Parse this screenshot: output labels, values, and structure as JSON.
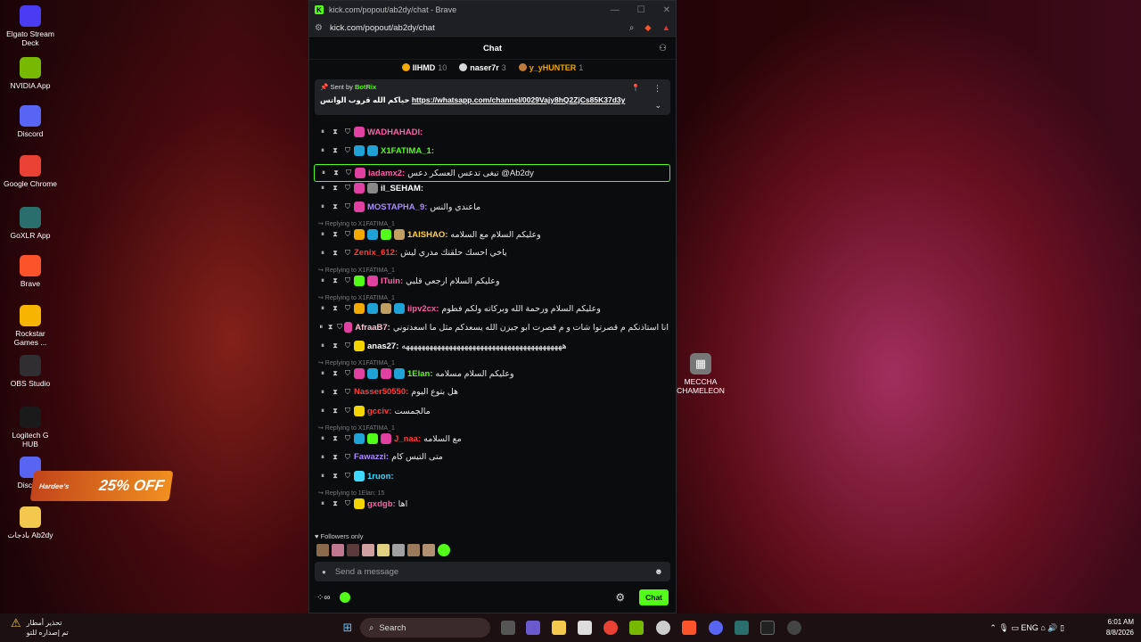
{
  "desktop_icons": [
    {
      "label": "Elgato Stream Deck",
      "icon": "stream-deck-icon",
      "color": "#4b3bf2"
    },
    {
      "label": "NVIDIA App",
      "icon": "nvidia-icon",
      "color": "#76b900"
    },
    {
      "label": "Discord",
      "icon": "discord-icon",
      "color": "#5865f2"
    },
    {
      "label": "Google Chrome",
      "icon": "chrome-icon",
      "color": "#e94235"
    },
    {
      "label": "GoXLR App",
      "icon": "goxlr-icon",
      "color": "#2b6e6e"
    },
    {
      "label": "Brave",
      "icon": "brave-icon",
      "color": "#fb542b"
    },
    {
      "label": "Rockstar Games ...",
      "icon": "rockstar-icon",
      "color": "#f7b500"
    },
    {
      "label": "OBS Studio",
      "icon": "obs-icon",
      "color": "#302e31"
    },
    {
      "label": "Logitech G HUB",
      "icon": "logitech-icon",
      "color": "#1a1a1a"
    },
    {
      "label": "Discord",
      "icon": "discord-icon",
      "color": "#5865f2"
    },
    {
      "label": "بادجات Ab2dy",
      "icon": "folder-icon",
      "color": "#f2c94c"
    }
  ],
  "desktop_right_icon": {
    "label": "MECCHA CHAMELEON"
  },
  "promo": {
    "brand": "Hardee's",
    "text": "25% OFF"
  },
  "browser": {
    "title": "kick.com/popout/ab2dy/chat - Brave",
    "url": "kick.com/popout/ab2dy/chat"
  },
  "chat": {
    "header": "Chat",
    "leaders": [
      {
        "name": "IIHMD",
        "count": "10",
        "color": "#f2a900"
      },
      {
        "name": "naser7r",
        "count": "3",
        "color": "#d9d9d9"
      },
      {
        "name": "y_yHUNTER",
        "count": "1",
        "color": "#c07a3a"
      }
    ],
    "pinned": {
      "sent_by_label": "Sent by",
      "sender": "BotRix",
      "text": "حياكم الله قروب الواتس",
      "link": "https://whatsapp.com/channel/0029Vajy8hQ2ZjCs85K37d3y"
    },
    "replying_prefix": "Replying to",
    "messages": [
      {
        "user": "WADHAHADI",
        "color": "#ff5fa8",
        "text": "",
        "badges": [
          "#e040a0"
        ]
      },
      {
        "user": "X1FATIMA_1",
        "color": "#53fc18",
        "text": "",
        "badges": [
          "#1fa3d6",
          "#1fa3d6"
        ]
      },
      {
        "user": "iadamx2",
        "color": "#ff5fa8",
        "text": "تبغى تدعس العسكر دعس @Ab2dy",
        "badges": [
          "#e040a0"
        ],
        "highlight": true
      },
      {
        "user": "il_SEHAM",
        "color": "#ffffff",
        "text": "",
        "badges": [
          "#e040a0",
          "#888888"
        ]
      },
      {
        "user": "MOSTAPHA_9",
        "color": "#a98bff",
        "text": "ماعندي والنس",
        "badges": [
          "#e040a0"
        ]
      },
      {
        "reply_to": "X1FATIMA_1",
        "user": "1AISHAO",
        "color": "#ffd23f",
        "text": "وعليكم السلام مع السلامه",
        "badges": [
          "#f2a900",
          "#1fa3d6",
          "#53fc18",
          "#c0a060"
        ]
      },
      {
        "user": "Zenix_612",
        "color": "#ff3b3b",
        "text": "ياخي احسك حلقنك مدري ليش",
        "badges": []
      },
      {
        "reply_to": "X1FATIMA_1",
        "user": "ITuin",
        "color": "#ff5fa8",
        "text": "وعليكم السلام ارجعي قلبي",
        "badges": [
          "#53fc18",
          "#e040a0"
        ]
      },
      {
        "reply_to": "X1FATIMA_1",
        "user": "iipv2cx",
        "color": "#ff5fa8",
        "text": "وعليكم السلام ورحمة الله وبركاته ولكم فطوم",
        "badges": [
          "#f2a900",
          "#1fa3d6",
          "#c0a060",
          "#1fa3d6"
        ]
      },
      {
        "user": "AfraaB7",
        "color": "#ffc0d0",
        "text": "انا استاذنكم م قصرتوا شات و م قصرت ابو جيزن الله يسعدكم مثل ما اسعدتوني",
        "badges": [
          "#e040a0"
        ]
      },
      {
        "user": "anas27",
        "color": "#ffffff",
        "text": "هههههههههههههههههههههههههههههههههههههههههه",
        "badges": [
          "#f2d400"
        ]
      },
      {
        "reply_to": "X1FATIMA_1",
        "user": "1Elan",
        "color": "#53fc18",
        "text": "وعليكم السلام مسلامه",
        "badges": [
          "#e040a0",
          "#1fa3d6",
          "#e040a0",
          "#1fa3d6"
        ]
      },
      {
        "user": "Nasser50550",
        "color": "#ff3b3b",
        "text": "هل بتوع اليوم",
        "badges": []
      },
      {
        "user": "gcciv",
        "color": "#ff3b3b",
        "text": "مالجمست",
        "badges": [
          "#f2d400"
        ]
      },
      {
        "reply_to": "X1FATIMA_1",
        "user": "J_naa",
        "color": "#ff3b3b",
        "text": "مع السلامه",
        "badges": [
          "#1fa3d6",
          "#53fc18",
          "#e040a0"
        ]
      },
      {
        "user": "Fawazzi",
        "color": "#a98bff",
        "text": "متى التيس كام",
        "badges": []
      },
      {
        "user": "1ruon",
        "color": "#3fd9ff",
        "text": "",
        "badges": [
          "#3fd9ff"
        ]
      },
      {
        "reply_to": "1Elan: 15",
        "user": "gxdgb",
        "color": "#ff5fa8",
        "text": "اها",
        "badges": [
          "#f2d400"
        ]
      }
    ],
    "followers_only": "Followers only",
    "input_placeholder": "Send a message",
    "chat_button": "Chat"
  },
  "taskbar": {
    "weather_line1": "تحذير أمطار",
    "weather_line2": "تم إصداره للتو",
    "search": "Search",
    "lang": "ENG",
    "time": "6:01 AM",
    "date": "8/8/2026"
  }
}
